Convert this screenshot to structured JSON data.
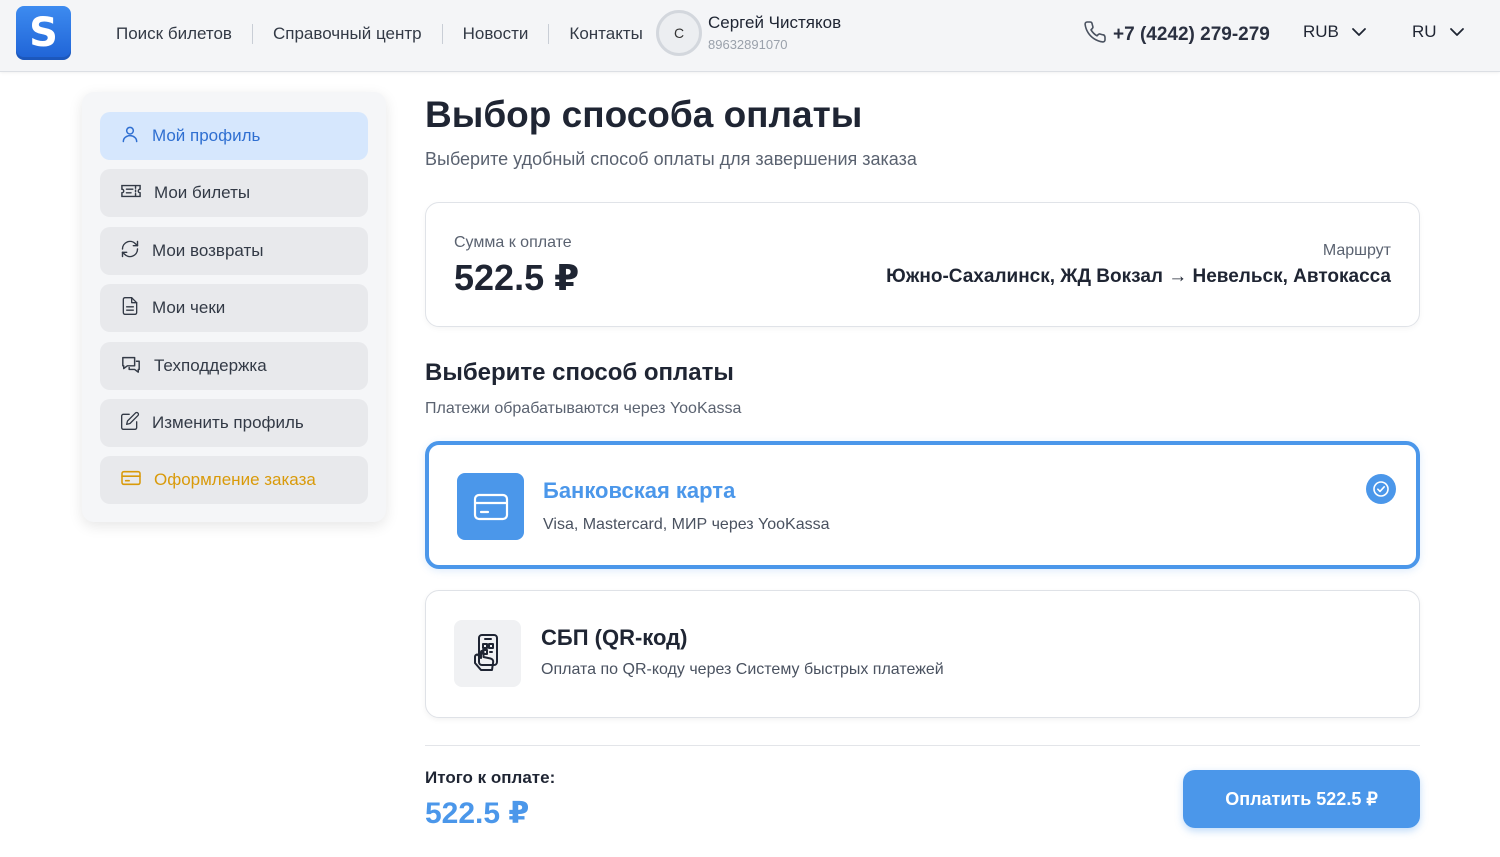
{
  "header": {
    "logo_letter": "S",
    "nav": [
      "Поиск билетов",
      "Справочный центр",
      "Новости",
      "Контакты"
    ],
    "user": {
      "avatar_letter": "С",
      "name": "Сергей Чистяков",
      "phone": "89632891070"
    },
    "phone": "+7 (4242) 279-279",
    "currency": "RUB",
    "language": "RU"
  },
  "sidebar": {
    "items": [
      {
        "label": "Мой профиль",
        "icon": "user-icon"
      },
      {
        "label": "Мои билеты",
        "icon": "ticket-icon"
      },
      {
        "label": "Мои возвраты",
        "icon": "refresh-icon"
      },
      {
        "label": "Мои чеки",
        "icon": "document-icon"
      },
      {
        "label": "Техподдержка",
        "icon": "chat-icon"
      },
      {
        "label": "Изменить профиль",
        "icon": "edit-icon"
      },
      {
        "label": "Оформление заказа",
        "icon": "credit-card-icon"
      }
    ]
  },
  "main": {
    "title": "Выбор способа оплаты",
    "subtitle": "Выберите удобный способ оплаты для завершения заказа",
    "summary": {
      "amount_label": "Сумма к оплате",
      "amount": "522.5 ₽",
      "route_label": "Маршрут",
      "route": "Южно-Сахалинск, ЖД Вокзал → Невельск, Автокасса"
    },
    "methods_title": "Выберите способ оплаты",
    "methods_subtitle": "Платежи обрабатываются через YooKassa",
    "methods": [
      {
        "title": "Банковская карта",
        "desc": "Visa, Mastercard, МИР через YooKassa",
        "selected": true
      },
      {
        "title": "СБП (QR-код)",
        "desc": "Оплата по QR-коду через Систему быстрых платежей",
        "selected": false
      }
    ],
    "total_label": "Итого к оплате:",
    "total": "522.5 ₽",
    "pay_button": "Оплатить 522.5 ₽"
  },
  "colors": {
    "accent": "#4b97ea",
    "active_sidebar_bg": "#d6e7fd",
    "order_item": "#d99a0a"
  }
}
